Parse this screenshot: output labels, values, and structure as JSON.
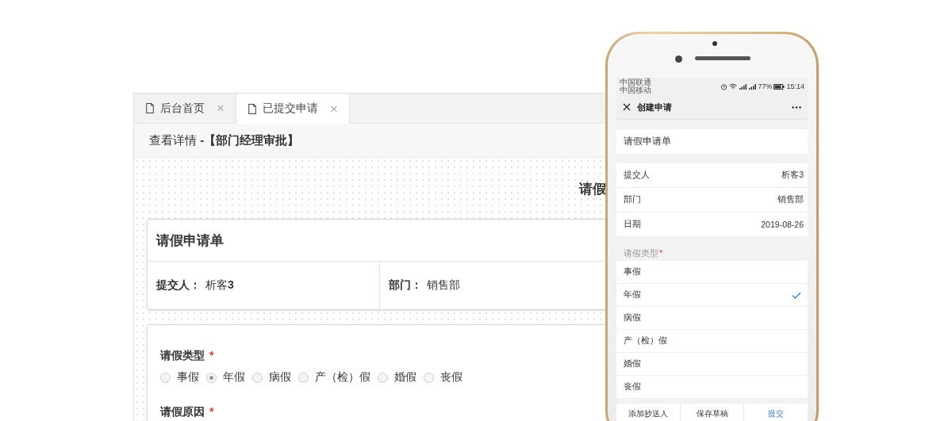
{
  "desktop": {
    "tabs": [
      {
        "label": "后台首页",
        "selected": false,
        "close": "×"
      },
      {
        "label": "已提交申请",
        "selected": true,
        "close": "×"
      }
    ],
    "breadcrumb": "查看详情 **-【部门经理审批】**",
    "page_title": "请假",
    "form_card": {
      "title": "请假申请单",
      "fields": [
        {
          "label": "提交人：",
          "value": "析客**3**"
        },
        {
          "label": "部门：",
          "value": "销售部"
        }
      ]
    },
    "leave_type": {
      "label": "请假类型",
      "required_mark": "*",
      "options": [
        {
          "label": "事假",
          "selected": false
        },
        {
          "label": "年假",
          "selected": true
        },
        {
          "label": "病假",
          "selected": false
        },
        {
          "label": "产（检）假",
          "selected": false
        },
        {
          "label": "婚假",
          "selected": false
        },
        {
          "label": "丧假",
          "selected": false
        }
      ]
    },
    "reason": {
      "label": "请假原因",
      "required_mark": "*"
    }
  },
  "phone": {
    "status_bar": {
      "carriers": [
        "中国联通",
        "中国移动"
      ],
      "battery": "77%",
      "time": "15:14"
    },
    "nav_title": "创建申请",
    "form_title": "请假申请单",
    "fields": [
      {
        "label": "提交人",
        "value": "析客3"
      },
      {
        "label": "部门",
        "value": "销售部"
      },
      {
        "label": "日期",
        "value": "2019-08-26"
      }
    ],
    "leave_type": {
      "label": "请假类型",
      "required_mark": "*",
      "options": [
        {
          "label": "事假",
          "selected": false
        },
        {
          "label": "年假",
          "selected": true
        },
        {
          "label": "病假",
          "selected": false
        },
        {
          "label": "产（检）假",
          "selected": false
        },
        {
          "label": "婚假",
          "selected": false
        },
        {
          "label": "丧假",
          "selected": false
        }
      ]
    },
    "actions": [
      {
        "label": "添加抄送人",
        "kind": "default"
      },
      {
        "label": "保存草稿",
        "kind": "default"
      },
      {
        "label": "提交",
        "kind": "primary"
      }
    ]
  }
}
